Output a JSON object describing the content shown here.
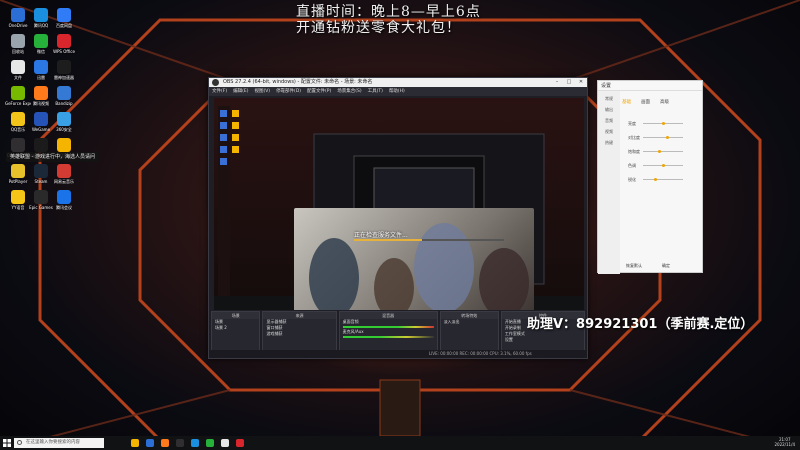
{
  "banner": {
    "line1": "直播时间：晚上8—早上6点",
    "line2": "开通钻粉送零食大礼包！"
  },
  "assistant_text": "助理V：892921301（季前赛.定位）",
  "desktop_icons": [
    {
      "label": "OneDrive",
      "color": "#2b6fd6",
      "icon": "cloud-icon"
    },
    {
      "label": "腾讯QQ",
      "color": "#1a8fe0",
      "icon": "qq-icon"
    },
    {
      "label": "百度网盘",
      "color": "#2f7cf6",
      "icon": "disk-icon"
    },
    {
      "label": "回收站",
      "color": "#9aa4ad",
      "icon": "recycle-bin-icon"
    },
    {
      "label": "微信",
      "color": "#25b13a",
      "icon": "wechat-icon"
    },
    {
      "label": "WPS Office",
      "color": "#d9262c",
      "icon": "wps-icon"
    },
    {
      "label": "文件",
      "color": "#e7e7e7",
      "icon": "file-icon"
    },
    {
      "label": "迅雷",
      "color": "#2b78e4",
      "icon": "thunder-icon"
    },
    {
      "label": "雷神加速器",
      "color": "#1d1d1d",
      "icon": "accelerator-icon"
    },
    {
      "label": "GeForce Experience",
      "color": "#77b900",
      "icon": "geforce-icon"
    },
    {
      "label": "腾讯视频",
      "color": "#ff7a1a",
      "icon": "video-icon"
    },
    {
      "label": "Bandizip",
      "color": "#3479d3",
      "icon": "zip-icon"
    },
    {
      "label": "QQ音乐",
      "color": "#f2c318",
      "icon": "music-icon"
    },
    {
      "label": "WeGame",
      "color": "#2553b8",
      "icon": "wegame-icon"
    },
    {
      "label": "360安全",
      "color": "#3aa0e6",
      "icon": "shield-icon"
    },
    {
      "label": "OBS Studio",
      "color": "#302e31",
      "icon": "obs-icon"
    },
    {
      "label": "Logitech G HUB",
      "color": "#1b1b1b",
      "icon": "logitech-icon"
    },
    {
      "label": "QQ游戏",
      "color": "#f4b400",
      "icon": "game-icon"
    },
    {
      "label": "PotPlayer",
      "color": "#e8c22a",
      "icon": "player-icon"
    },
    {
      "label": "Steam",
      "color": "#1b2838",
      "icon": "steam-icon"
    },
    {
      "label": "网易云音乐",
      "color": "#d43c33",
      "icon": "netease-icon"
    },
    {
      "label": "YY语音",
      "color": "#f5c518",
      "icon": "yy-icon"
    },
    {
      "label": "Epic Games",
      "color": "#2a2a2a",
      "icon": "epic-icon"
    },
    {
      "label": "腾讯会议",
      "color": "#1a73e8",
      "icon": "meeting-icon"
    }
  ],
  "tooltip_text": "英雄联盟 - 游戏进行中，海选人员请问",
  "obs": {
    "title": "OBS 27.2.4 (64-bit, windows) - 配置文件: 未命名 - 场景: 未命名",
    "menu": [
      "文件(F)",
      "编辑(E)",
      "视图(V)",
      "停靠部件(D)",
      "配置文件(P)",
      "场景集合(S)",
      "工具(T)",
      "帮助(H)"
    ],
    "preview_label": "正在检查服务文件...",
    "progress": 0.45,
    "docks": {
      "scenes": {
        "header": "场景",
        "items": [
          "场景",
          "场景 2"
        ]
      },
      "sources": {
        "header": "来源",
        "items": [
          "显示器捕获",
          "窗口捕获",
          "游戏捕获"
        ]
      },
      "mixer": {
        "header": "混音器",
        "items": [
          "桌面音频",
          "麦克风/Aux"
        ]
      },
      "transitions": {
        "header": "转场特效",
        "items": [
          "淡入淡出"
        ]
      },
      "controls": {
        "header": "控件",
        "items": [
          "开始直播",
          "开始录制",
          "工作室模式",
          "设置",
          "退出"
        ]
      }
    },
    "status": "LIVE: 00:00:00   REC: 00:00:00   CPU: 3.1%, 60.00 fps"
  },
  "panel": {
    "title": "设置",
    "tabs": [
      "基础",
      "画面",
      "高级"
    ],
    "side_items": [
      "常规",
      "输出",
      "音频",
      "视频",
      "热键"
    ],
    "rows": [
      {
        "label": "亮度",
        "value": 0.5
      },
      {
        "label": "对比度",
        "value": 0.6
      },
      {
        "label": "饱和度",
        "value": 0.4
      },
      {
        "label": "色调",
        "value": 0.5
      },
      {
        "label": "锐化",
        "value": 0.3
      }
    ],
    "footer": [
      "恢复默认",
      "确定"
    ]
  },
  "taskbar": {
    "search_placeholder": "在这里输入你要搜索的内容",
    "apps": [
      "#f4b400",
      "#2b6fd6",
      "#ff7a1a",
      "#302e31",
      "#1a8fe0",
      "#25b13a",
      "#e7e7e7",
      "#d9262c"
    ],
    "time": "21:07",
    "date": "2022/11/4"
  }
}
